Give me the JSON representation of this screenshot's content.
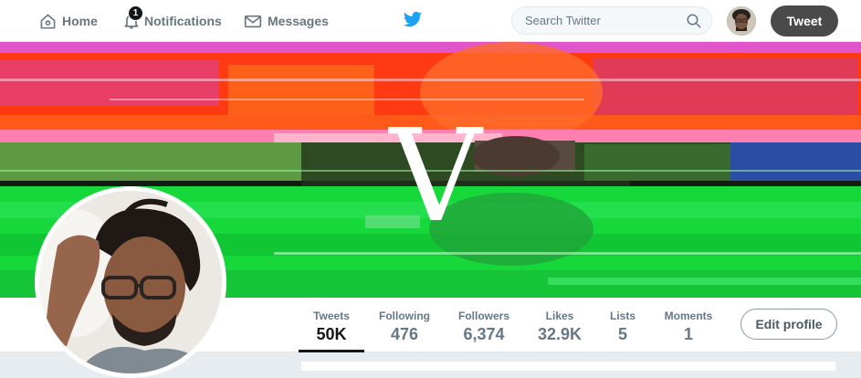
{
  "nav": {
    "home": "Home",
    "notifications": "Notifications",
    "notifications_badge": "1",
    "messages": "Messages",
    "search_placeholder": "Search Twitter",
    "tweet_button": "Tweet",
    "icons": [
      "home-icon",
      "bell-icon",
      "envelope-icon",
      "twitter-bird-icon",
      "search-icon"
    ],
    "brand_color": "#1da1f2"
  },
  "banner": {
    "letter": "V"
  },
  "profile_nav": {
    "stats": [
      {
        "label": "Tweets",
        "value": "50K",
        "active": true
      },
      {
        "label": "Following",
        "value": "476"
      },
      {
        "label": "Followers",
        "value": "6,374"
      },
      {
        "label": "Likes",
        "value": "32.9K"
      },
      {
        "label": "Lists",
        "value": "5"
      },
      {
        "label": "Moments",
        "value": "1"
      }
    ],
    "edit_profile": "Edit profile"
  }
}
